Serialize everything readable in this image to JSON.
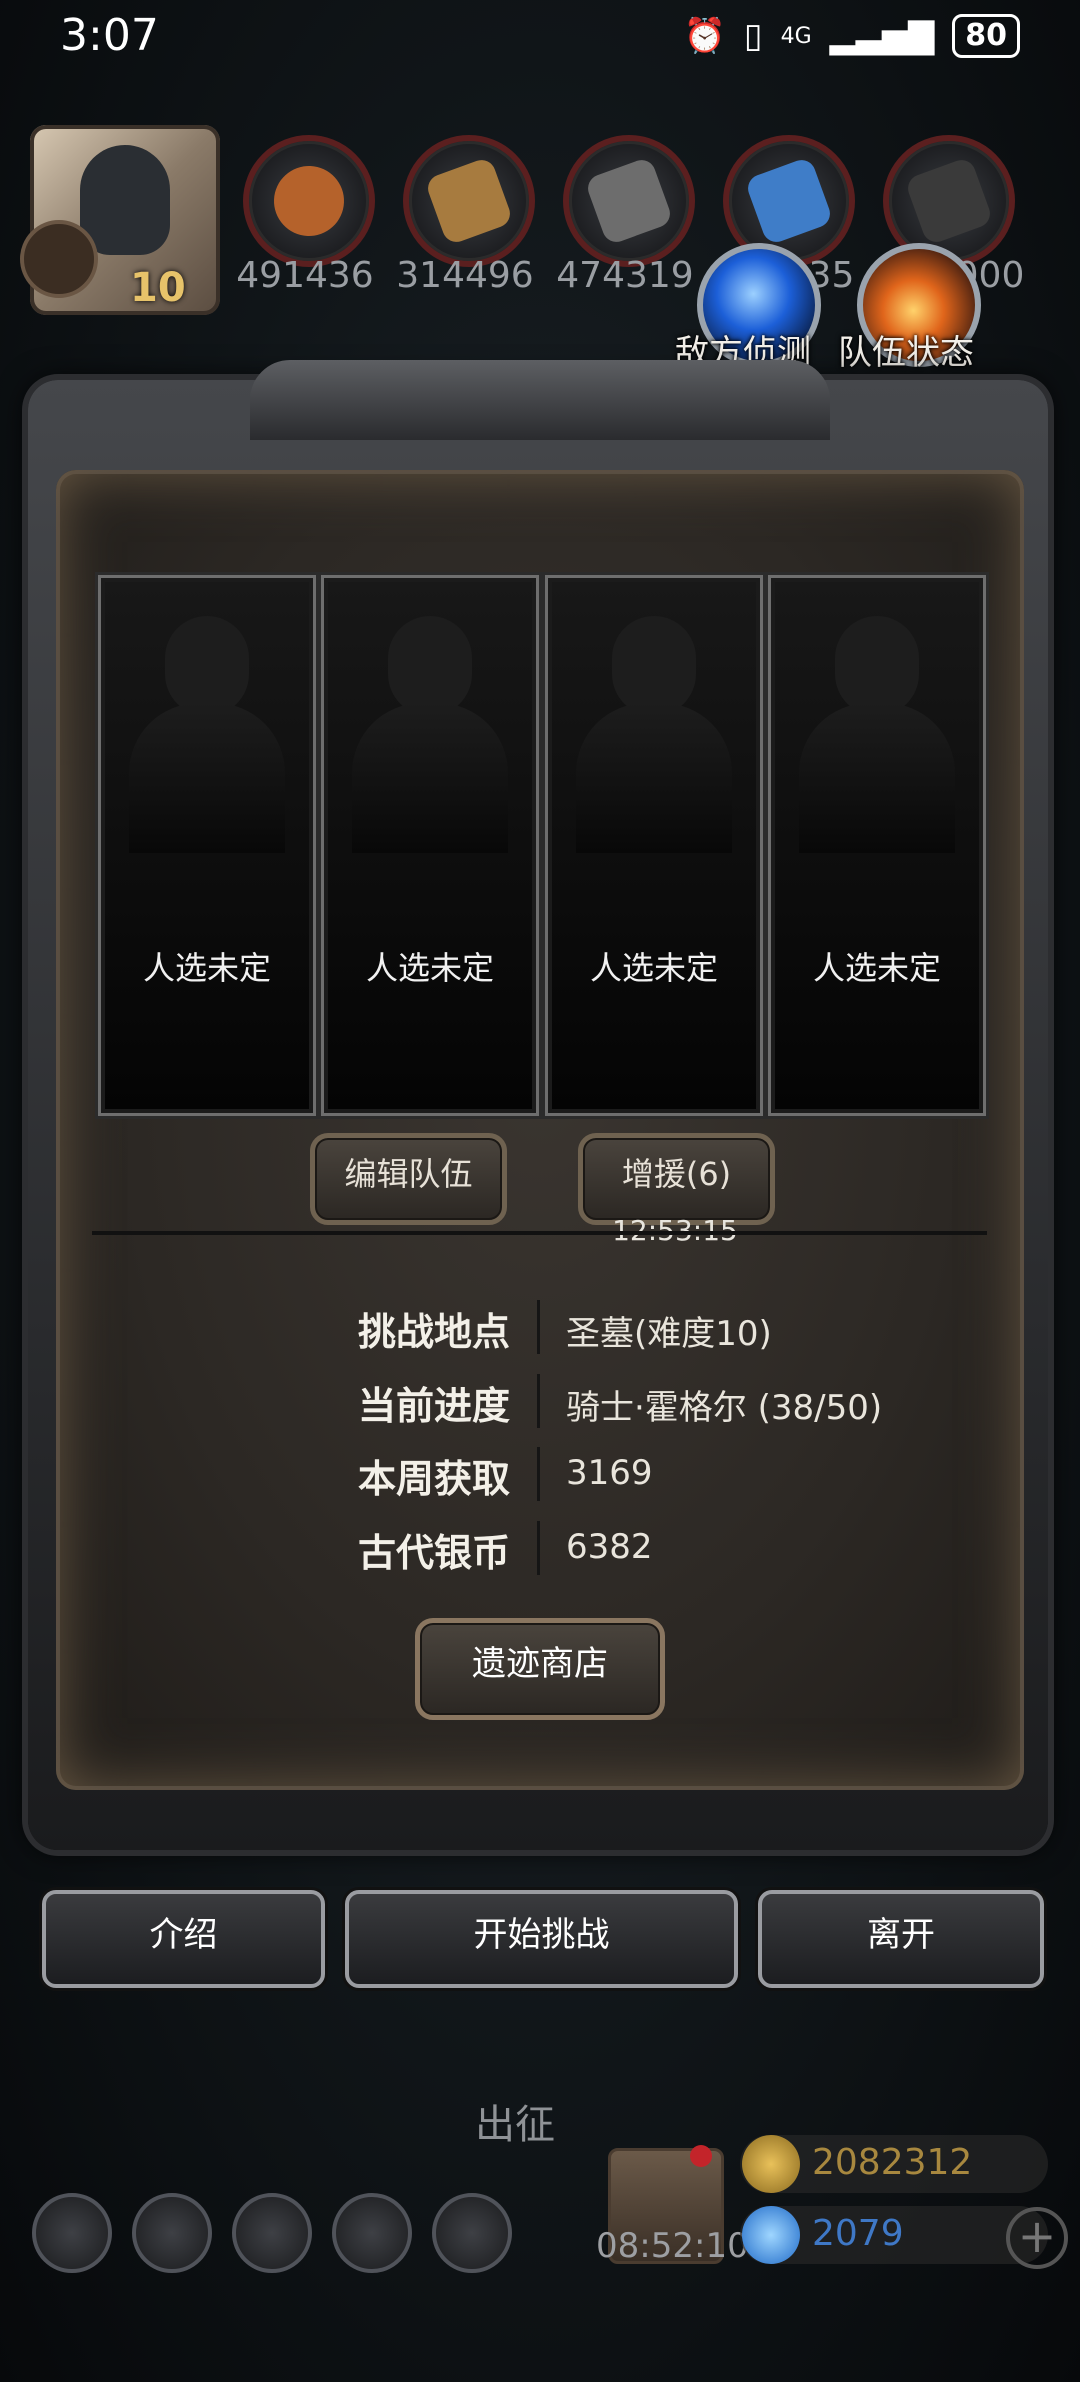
{
  "status_bar": {
    "time": "3:07",
    "network": "4G",
    "battery": "80"
  },
  "player": {
    "level": "10"
  },
  "resources": [
    {
      "icon": "meat-icon",
      "value": "491436",
      "color": "#b5622b"
    },
    {
      "icon": "wood-icon",
      "value": "314496",
      "color": "#a77b3f"
    },
    {
      "icon": "iron-icon",
      "value": "474319",
      "color": "#6d6d6d"
    },
    {
      "icon": "crystal-icon",
      "value": "835",
      "color": "#3f7dc8"
    },
    {
      "icon": "stone-icon",
      "value": "000",
      "color": "#3a3a3a"
    }
  ],
  "quick_actions": {
    "scout_label": "敌方侦测",
    "team_status_label": "队伍状态"
  },
  "slots": [
    {
      "label": "人选未定"
    },
    {
      "label": "人选未定"
    },
    {
      "label": "人选未定"
    },
    {
      "label": "人选未定"
    }
  ],
  "team_buttons": {
    "edit_label": "编辑队伍",
    "reinforce_label": "增援(6)",
    "reinforce_timer": "12:53:15"
  },
  "info": {
    "location_label": "挑战地点",
    "location_value": "圣墓(难度10)",
    "progress_label": "当前进度",
    "progress_value": "骑士·霍格尔 (38/50)",
    "weekly_label": "本周获取",
    "weekly_value": "3169",
    "coins_label": "古代银币",
    "coins_value": "6382"
  },
  "shop_button": "遗迹商店",
  "actions": {
    "intro": "介绍",
    "start": "开始挑战",
    "leave": "离开"
  },
  "bottom": {
    "depart_label": "出征",
    "gift_timer": "08:52:10",
    "gold": "2082312",
    "gems": "2079"
  }
}
